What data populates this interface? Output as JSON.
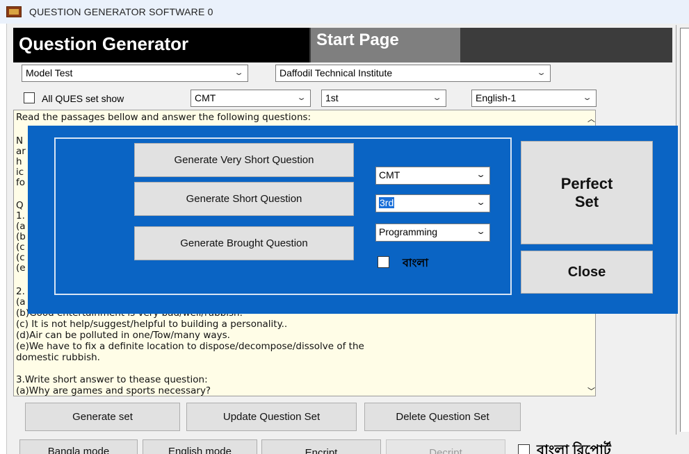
{
  "window": {
    "title": "QUESTION GENERATOR SOFTWARE 0"
  },
  "header": {
    "title": "Question Generator",
    "start_page": "Start Page"
  },
  "filters": {
    "exam_type": "Model Test",
    "institute": "Daffodil Technical Institute",
    "show_all_label": "All QUES set show",
    "department": "CMT",
    "semester": "1st",
    "subject": "English-1"
  },
  "passage": {
    "lines": [
      "Read the passages bellow and answer the following questions:",
      "",
      "N",
      "ar",
      "h",
      "ic",
      "fo",
      "",
      "Q",
      "1.",
      "(a",
      "(b",
      "(c",
      "(c",
      "(e",
      "",
      "2.",
      "(a",
      "(b)Good entertainment is very bad/well/rubbish.",
      "(c) It is not help/suggest/helpful to building a personality..",
      "(d)Air can be polluted in one/Tow/many ways.",
      "(e)We have to fix a definite location to dispose/decompose/dissolve of the",
      "domestic rubbish.",
      "",
      "3.Write short answer to thease question:",
      "(a)Why are games and sports necessary?"
    ]
  },
  "dialog": {
    "very_short_btn": "Generate Very Short Question",
    "short_btn": "Generate Short Question",
    "broad_btn": "Generate Brought Question",
    "department": "CMT",
    "semester": "3rd",
    "subject": "Programming",
    "bangla_label": "বাংলা",
    "perfect_set_btn": "Perfect Set",
    "close_btn": "Close"
  },
  "actions": {
    "generate_set": "Generate set",
    "update_set": "Update Question Set",
    "delete_set": "Delete Question Set"
  },
  "bottom": {
    "bangla_mode": "Bangla mode",
    "english_mode": "English mode",
    "encript": "Encript",
    "decript": "Decript",
    "bangla_report": "বাংলা রিপোর্ট"
  },
  "colors": {
    "dialog_blue": "#0a64c4",
    "textarea_bg": "#fffde7",
    "header_black": "#000000"
  }
}
